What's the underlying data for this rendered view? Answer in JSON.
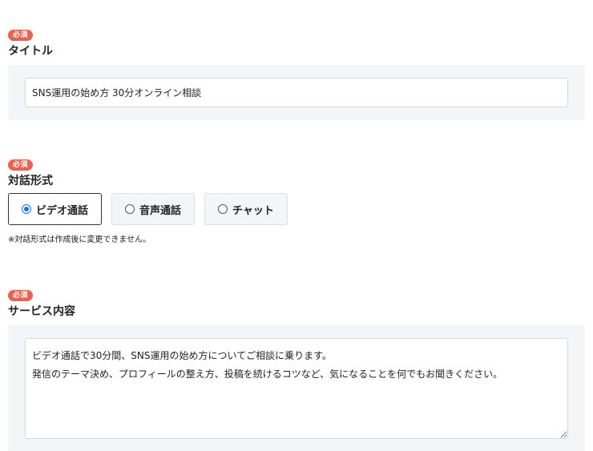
{
  "title_section": {
    "badge": "必須",
    "label": "タイトル",
    "value": "SNS運用の始め方 30分オンライン相談"
  },
  "format_section": {
    "badge": "必須",
    "label": "対話形式",
    "options": [
      {
        "label": "ビデオ通話",
        "selected": true
      },
      {
        "label": "音声通話",
        "selected": false
      },
      {
        "label": "チャット",
        "selected": false
      }
    ],
    "note": "※対話形式は作成後に変更できません。"
  },
  "service_section": {
    "badge": "必須",
    "label": "サービス内容",
    "value": "ビデオ通話で30分間、SNS運用の始め方についてご相談に乗ります。\n発信のテーマ決め、プロフィールの整え方、投稿を続けるコツなど、気になることを何でもお聞きください。"
  },
  "colors": {
    "required_badge": "#e8624f",
    "radio_accent": "#1a73e8",
    "panel_background": "#f4f5f8"
  }
}
